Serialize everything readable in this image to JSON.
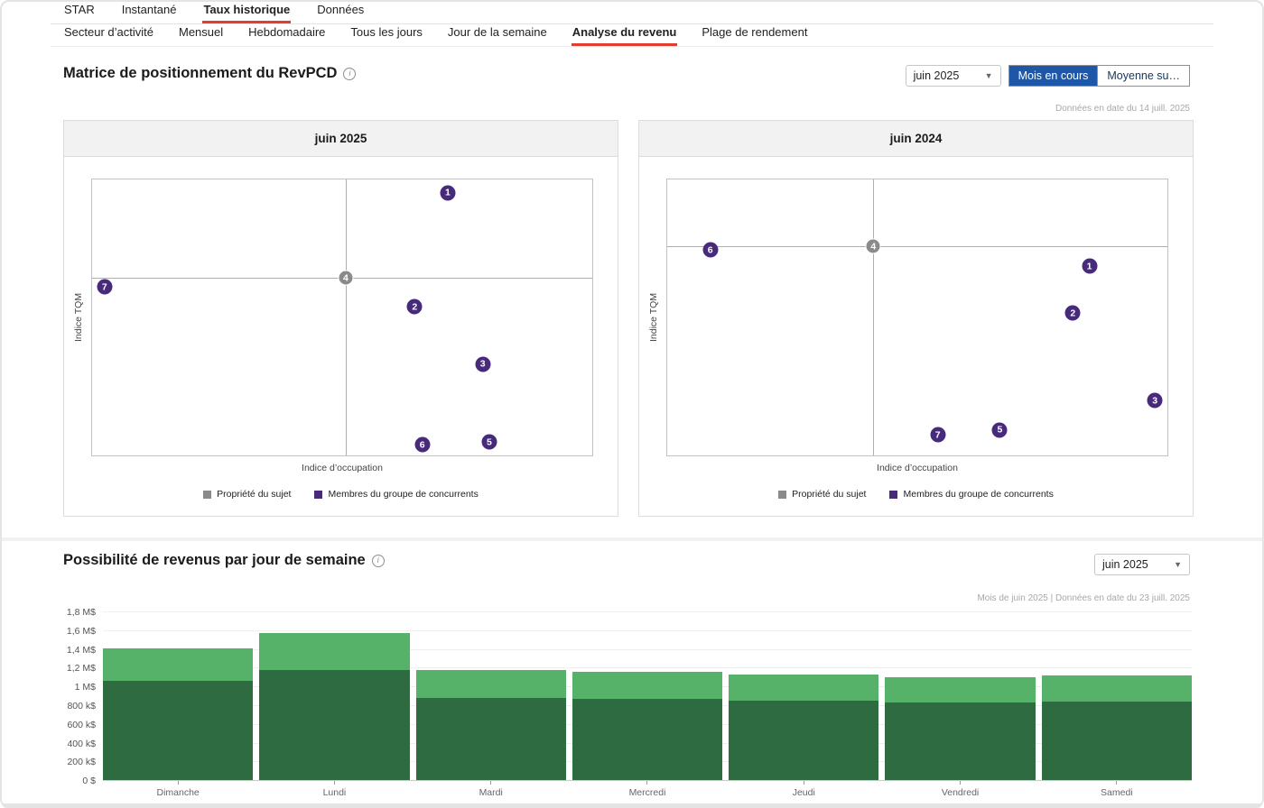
{
  "nav": {
    "primary": [
      {
        "label": "STAR",
        "active": false
      },
      {
        "label": "Instantané",
        "active": false
      },
      {
        "label": "Taux historique",
        "active": true
      },
      {
        "label": "Données",
        "active": false
      }
    ],
    "secondary": [
      {
        "label": "Secteur d’activité",
        "active": false
      },
      {
        "label": "Mensuel",
        "active": false
      },
      {
        "label": "Hebdomadaire",
        "active": false
      },
      {
        "label": "Tous les jours",
        "active": false
      },
      {
        "label": "Jour de la semaine",
        "active": false
      },
      {
        "label": "Analyse du revenu",
        "active": true
      },
      {
        "label": "Plage de rendement",
        "active": false
      }
    ]
  },
  "matrix_section": {
    "title": "Matrice de positionnement du RevPCD",
    "info_icon": "i",
    "month_select": {
      "value": "juin 2025"
    },
    "toggle": [
      {
        "label": "Mois en cours",
        "active": true
      },
      {
        "label": "Moyenne su…",
        "active": false
      }
    ],
    "data_note": "Données en date du 14 juill. 2025",
    "axis": {
      "x": "Indice d’occupation",
      "y": "Indice TQM"
    },
    "legend": [
      {
        "label": "Propriété du sujet",
        "type": "subject"
      },
      {
        "label": "Membres du groupe de concurrents",
        "type": "competitor"
      }
    ]
  },
  "revenue_section": {
    "title": "Possibilité de revenus par jour de semaine",
    "info_icon": "i",
    "month_select": {
      "value": "juin 2025"
    },
    "data_note": "Mois de juin 2025 | Données en date du 23 juill. 2025"
  },
  "colors": {
    "accent_red": "#e23d2e",
    "active_blue": "#1e56a8",
    "competitor_purple": "#472a7c",
    "subject_gray": "#8a8a8a",
    "bar_dark_green": "#2e6b41",
    "bar_light_green": "#57b269"
  },
  "chart_data": [
    {
      "type": "scatter",
      "title": "juin 2025",
      "xlabel": "Indice d’occupation",
      "ylabel": "Indice TQM",
      "crosshair": {
        "x_pct": 50.7,
        "y_pct": 35.7
      },
      "points": [
        {
          "label": "1",
          "x_pct": 71.1,
          "y_pct": 4.9,
          "series": "competitor"
        },
        {
          "label": "2",
          "x_pct": 64.5,
          "y_pct": 46.1,
          "series": "competitor"
        },
        {
          "label": "3",
          "x_pct": 78.1,
          "y_pct": 66.9,
          "series": "competitor"
        },
        {
          "label": "4",
          "x_pct": 50.7,
          "y_pct": 35.7,
          "series": "subject"
        },
        {
          "label": "5",
          "x_pct": 79.4,
          "y_pct": 95.1,
          "series": "competitor"
        },
        {
          "label": "6",
          "x_pct": 66.0,
          "y_pct": 96.1,
          "series": "competitor"
        },
        {
          "label": "7",
          "x_pct": 2.5,
          "y_pct": 39.0,
          "series": "competitor"
        }
      ]
    },
    {
      "type": "scatter",
      "title": "juin 2024",
      "xlabel": "Indice d’occupation",
      "ylabel": "Indice TQM",
      "crosshair": {
        "x_pct": 41.2,
        "y_pct": 24.2
      },
      "points": [
        {
          "label": "1",
          "x_pct": 84.4,
          "y_pct": 31.4,
          "series": "competitor"
        },
        {
          "label": "2",
          "x_pct": 81.1,
          "y_pct": 48.4,
          "series": "competitor"
        },
        {
          "label": "3",
          "x_pct": 97.5,
          "y_pct": 80.1,
          "series": "competitor"
        },
        {
          "label": "4",
          "x_pct": 41.2,
          "y_pct": 24.2,
          "series": "subject"
        },
        {
          "label": "5",
          "x_pct": 66.5,
          "y_pct": 90.8,
          "series": "competitor"
        },
        {
          "label": "6",
          "x_pct": 8.6,
          "y_pct": 25.5,
          "series": "competitor"
        },
        {
          "label": "7",
          "x_pct": 54.1,
          "y_pct": 92.5,
          "series": "competitor"
        }
      ]
    },
    {
      "type": "bar",
      "title": "Possibilité de revenus par jour de semaine",
      "categories": [
        "Dimanche",
        "Lundi",
        "Mardi",
        "Mercredi",
        "Jeudi",
        "Vendredi",
        "Samedi"
      ],
      "series": [
        {
          "name": "base",
          "values": [
            1070000,
            1190000,
            890000,
            880000,
            860000,
            840000,
            850000
          ]
        },
        {
          "name": "opportunity",
          "values": [
            350000,
            390000,
            300000,
            290000,
            280000,
            270000,
            280000
          ]
        }
      ],
      "ylim": [
        0,
        1850000
      ],
      "yticks": [
        {
          "value": 0,
          "label": "0 $"
        },
        {
          "value": 200000,
          "label": "200 k$"
        },
        {
          "value": 400000,
          "label": "400 k$"
        },
        {
          "value": 600000,
          "label": "600 k$"
        },
        {
          "value": 800000,
          "label": "800 k$"
        },
        {
          "value": 1000000,
          "label": "1 M$"
        },
        {
          "value": 1200000,
          "label": "1,2 M$"
        },
        {
          "value": 1400000,
          "label": "1,4 M$"
        },
        {
          "value": 1600000,
          "label": "1,6 M$"
        },
        {
          "value": 1800000,
          "label": "1,8 M$"
        }
      ]
    }
  ]
}
